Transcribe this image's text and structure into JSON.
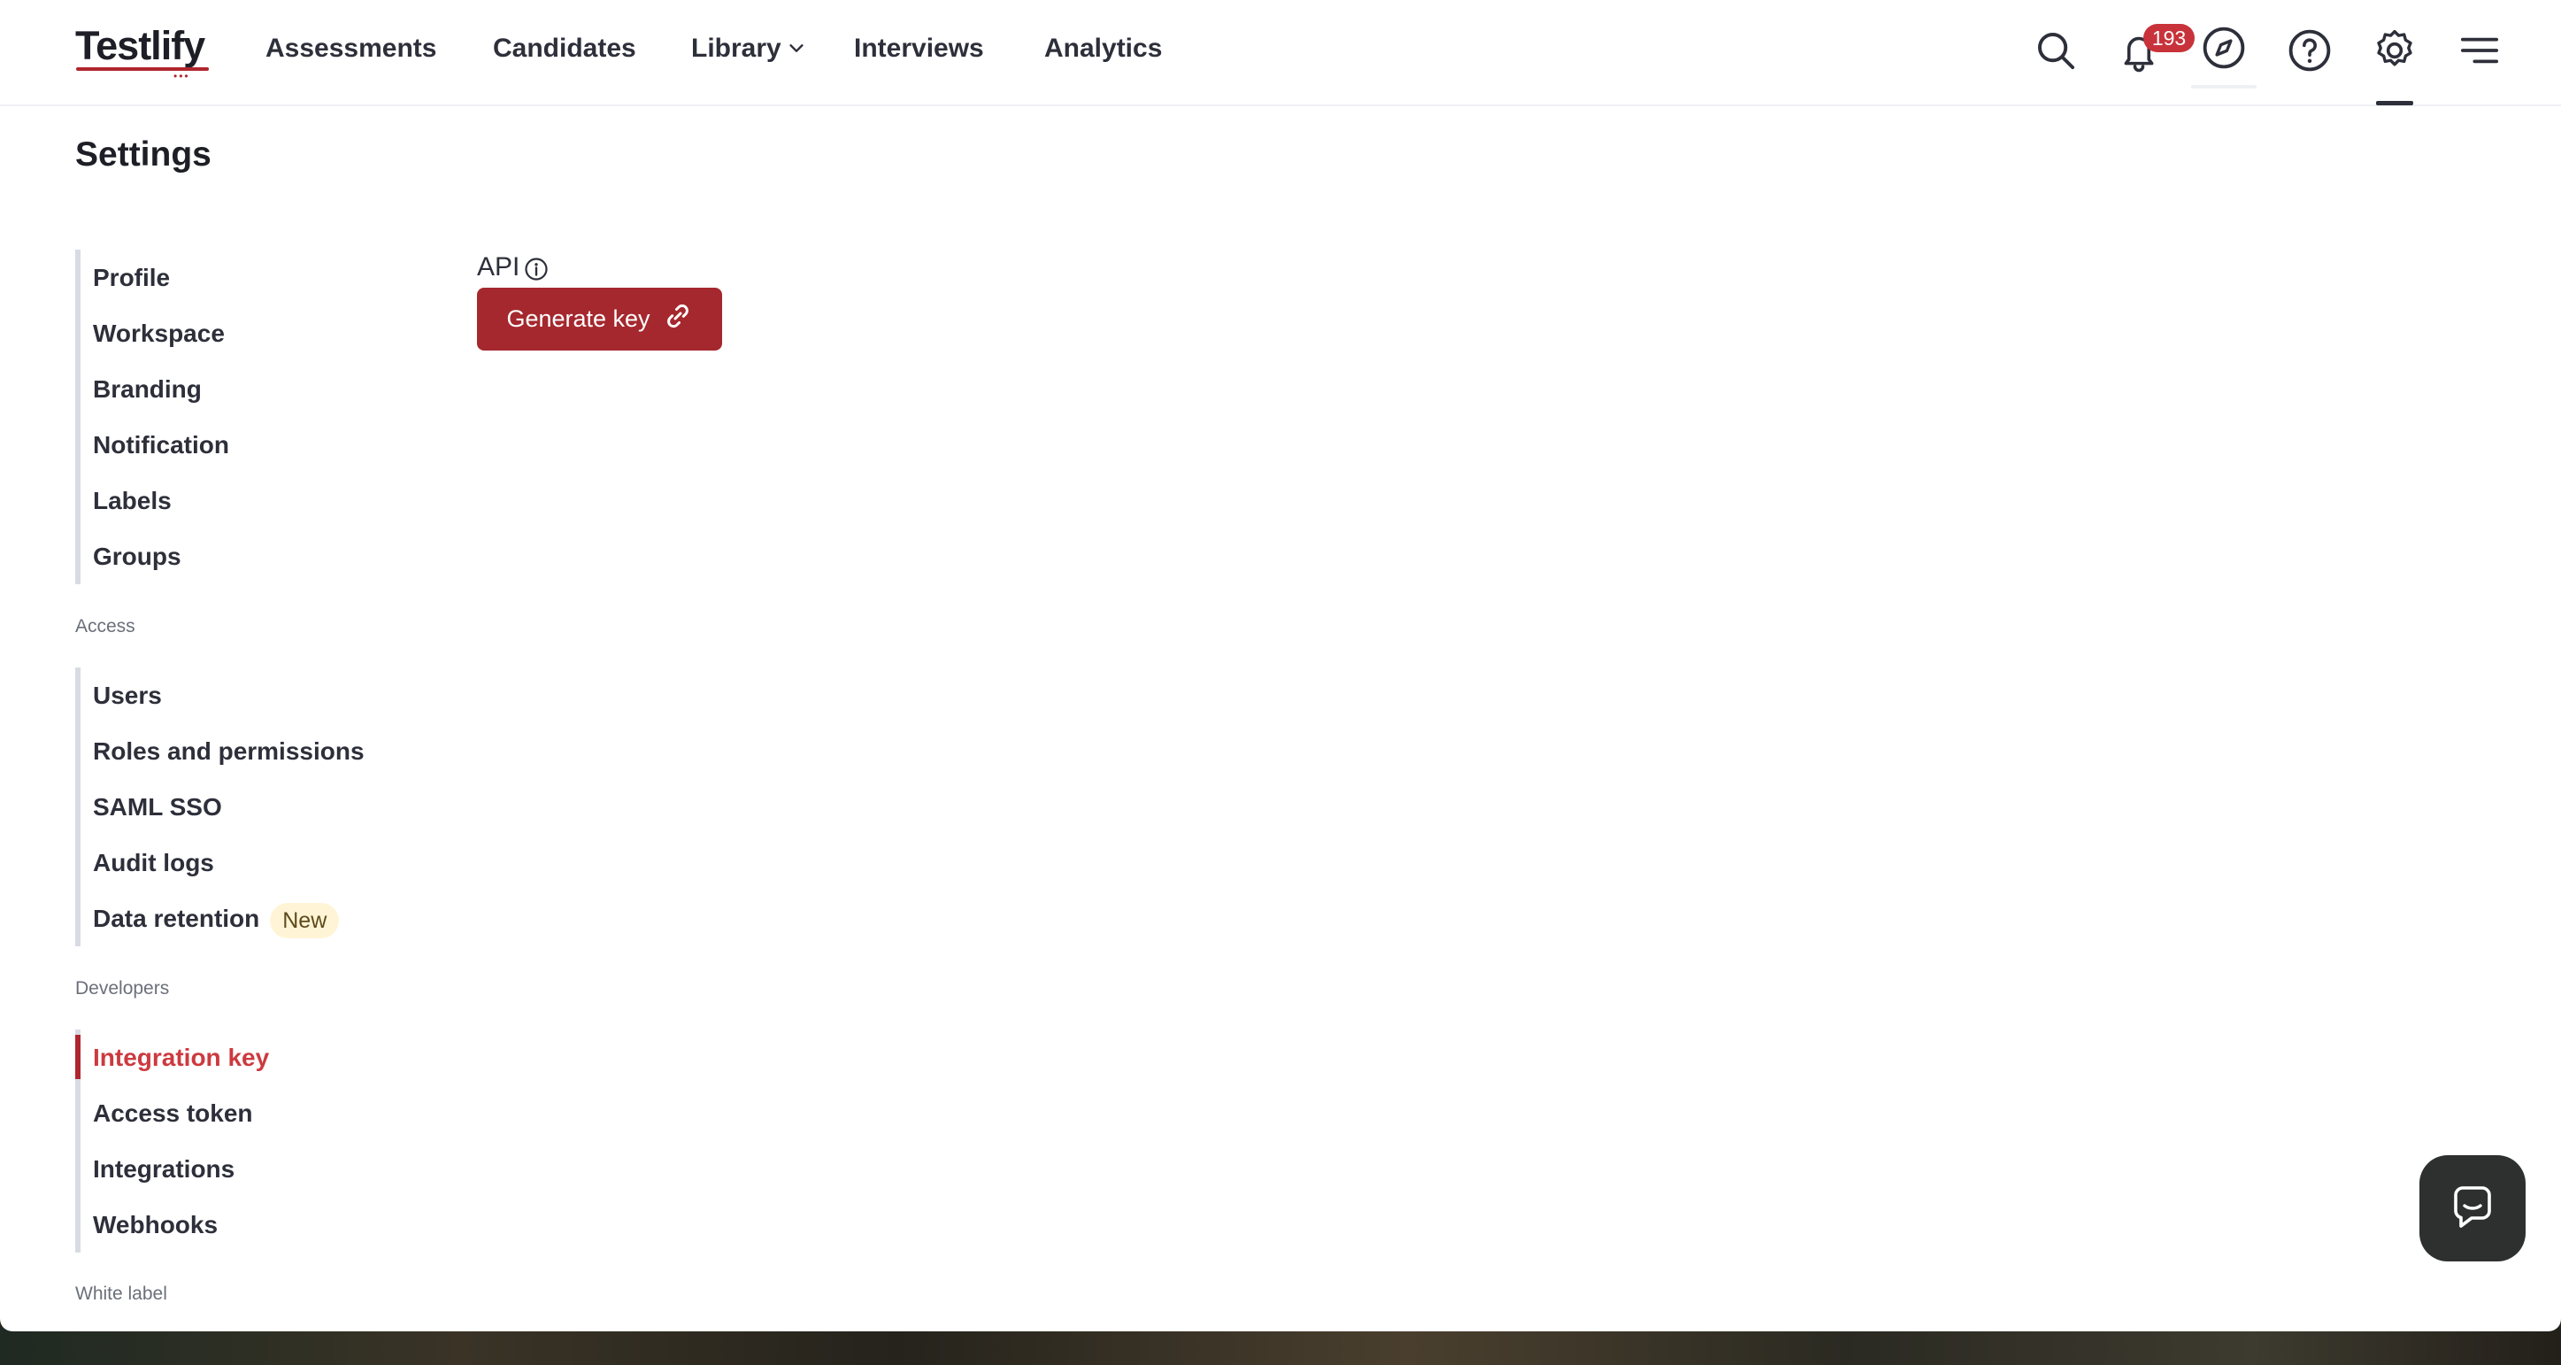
{
  "brand": {
    "name": "Testlify",
    "accent": "#a5282e"
  },
  "nav": {
    "items": [
      "Assessments",
      "Candidates",
      "Library",
      "Interviews",
      "Analytics"
    ],
    "notifications_count": "193"
  },
  "page_title": "Settings",
  "sidebar": {
    "general": [
      "Profile",
      "Workspace",
      "Branding",
      "Notification",
      "Labels",
      "Groups"
    ],
    "access_label": "Access",
    "access": [
      "Users",
      "Roles and permissions",
      "SAML SSO",
      "Audit logs",
      "Data retention"
    ],
    "new_badge": "New",
    "developers_label": "Developers",
    "developers": [
      "Integration key",
      "Access token",
      "Integrations",
      "Webhooks"
    ],
    "active_item": "Integration key",
    "white_label_label": "White label"
  },
  "content": {
    "api_label": "API",
    "generate_button": "Generate key"
  }
}
